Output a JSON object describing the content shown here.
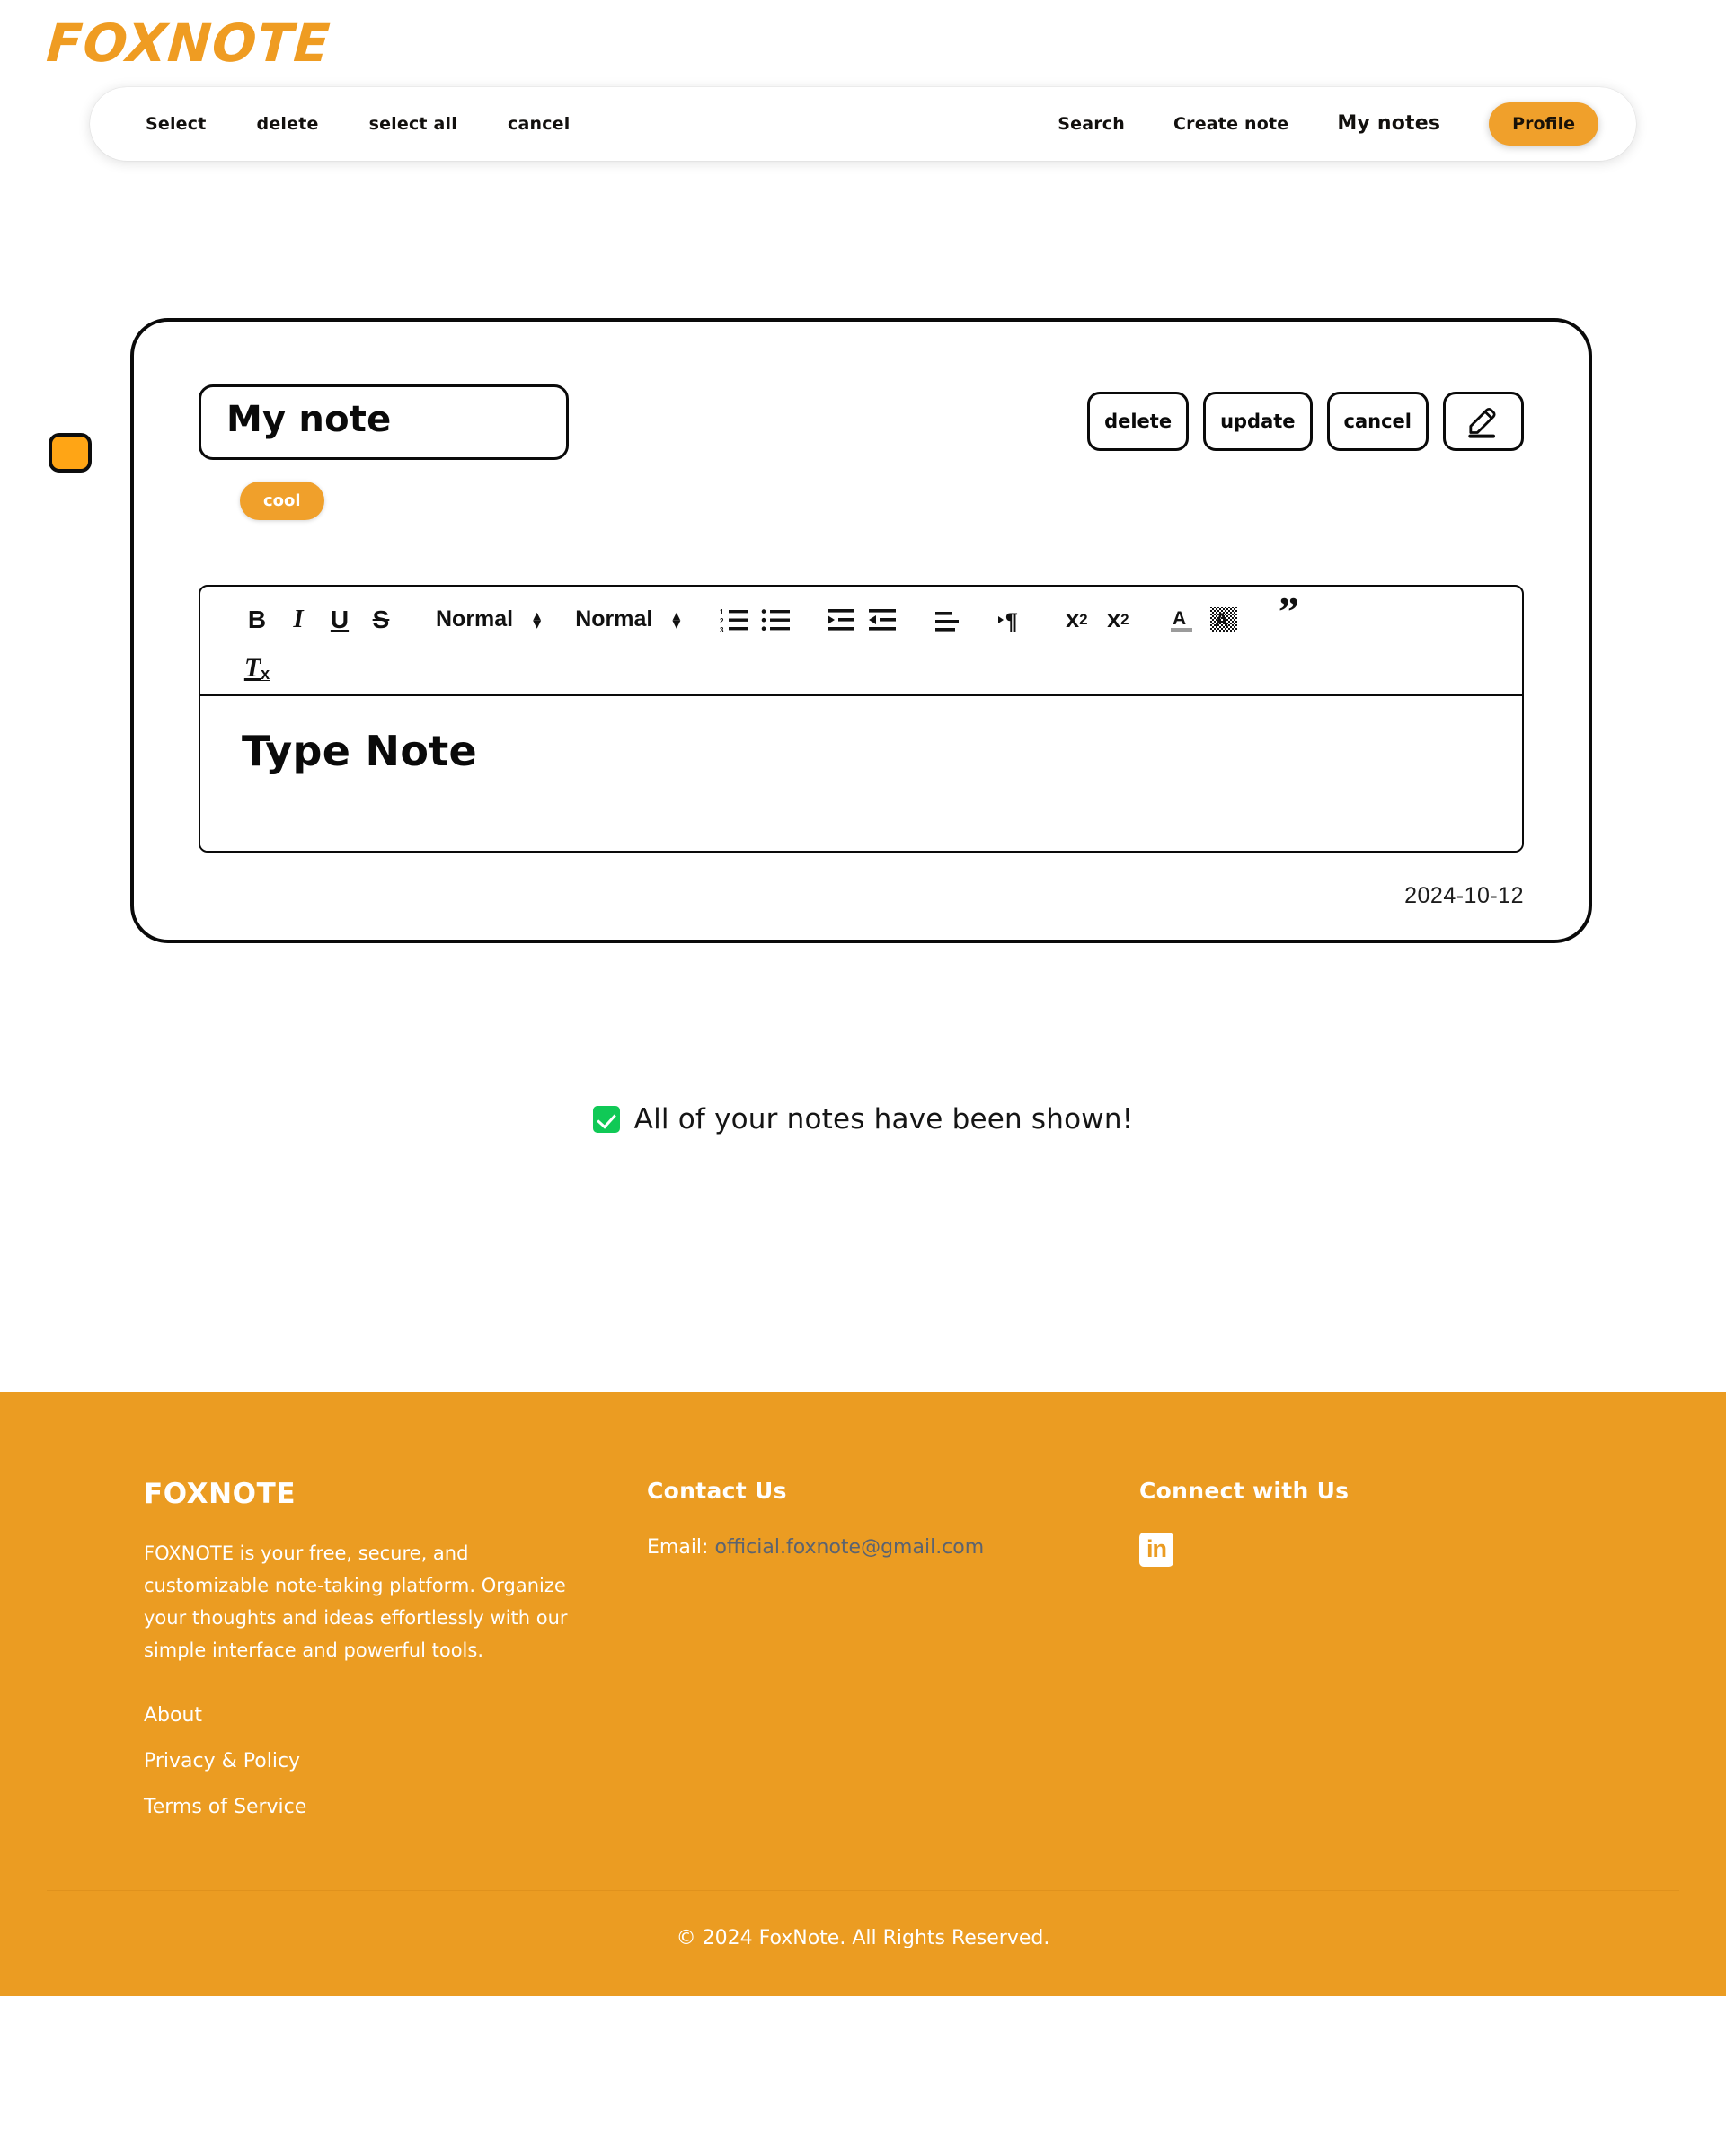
{
  "brand": {
    "logo": "FOXNOTE"
  },
  "nav": {
    "left_items": [
      {
        "label": "Select",
        "name": "select"
      },
      {
        "label": "delete",
        "name": "delete"
      },
      {
        "label": "select all",
        "name": "select-all"
      },
      {
        "label": "cancel",
        "name": "cancel"
      }
    ],
    "right_items": [
      {
        "label": "Search",
        "name": "search"
      },
      {
        "label": "Create note",
        "name": "create-note"
      },
      {
        "label": "My notes",
        "name": "my-notes"
      }
    ],
    "profile_label": "Profile"
  },
  "note": {
    "title": "My note",
    "tags": [
      "cool"
    ],
    "date": "2024-10-12",
    "actions": {
      "delete": "delete",
      "update": "update",
      "cancel": "cancel",
      "edit_icon": "pencil-icon"
    },
    "editor": {
      "placeholder": "Type Note",
      "toolbar": {
        "bold": "B",
        "italic": "I",
        "underline": "U",
        "strike": "S",
        "clear_format": "Tx",
        "header_select": "Normal",
        "font_select": "Normal",
        "subscript": "x",
        "subscript_idx": "2",
        "superscript": "x",
        "superscript_idx": "2",
        "color_letter": "A",
        "background_letter": "A",
        "quote": "”",
        "icons": [
          "ordered-list-icon",
          "bullet-list-icon",
          "indent-icon",
          "outdent-icon",
          "align-icon",
          "text-direction-icon",
          "subscript-icon",
          "superscript-icon",
          "text-color-icon",
          "background-color-icon",
          "blockquote-icon"
        ]
      }
    }
  },
  "status": {
    "message": "All of your notes have been shown!",
    "icon": "green-check-icon"
  },
  "footer": {
    "brand": "FOXNOTE",
    "description": "FOXNOTE is your free, secure, and customizable note-taking platform. Organize your thoughts and ideas effortlessly with our simple interface and powerful tools.",
    "links": [
      {
        "label": "About"
      },
      {
        "label": "Privacy & Policy"
      },
      {
        "label": "Terms of Service"
      }
    ],
    "contact_heading": "Contact Us",
    "email_label": "Email:",
    "email": "official.foxnote@gmail.com",
    "connect_heading": "Connect with Us",
    "social": [
      {
        "name": "linkedin-icon",
        "glyph": "in"
      }
    ],
    "copyright": "© 2024 FoxNote. All Rights Reserved."
  },
  "colors": {
    "brand_orange": "#ef9c22",
    "footer_orange": "#eb9c22",
    "pill_orange": "#f0a02b",
    "select_orange": "#ffa515",
    "check_green": "#10c956",
    "email_gray": "#5b6370"
  }
}
